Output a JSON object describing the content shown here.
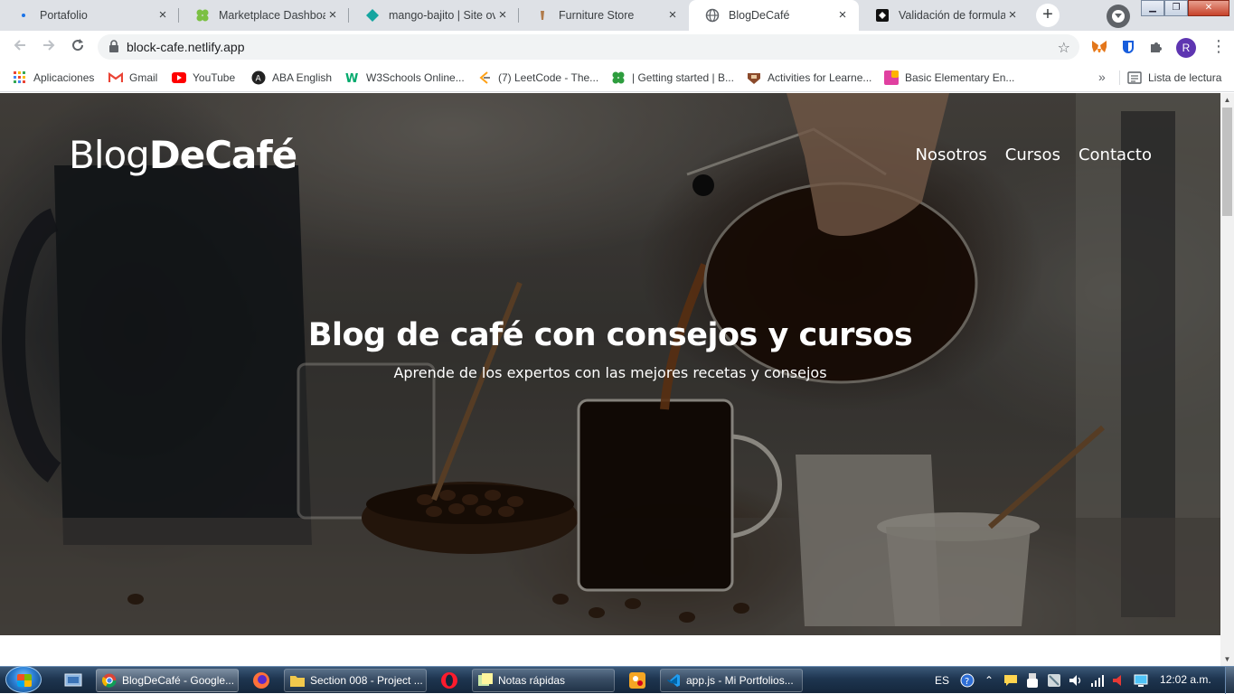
{
  "browser": {
    "tabs": [
      {
        "title": "Portafolio",
        "icon": "dot-icon",
        "active": false
      },
      {
        "title": "Marketplace Dashboard",
        "icon": "clover-icon",
        "active": false
      },
      {
        "title": "mango-bajito | Site overview",
        "icon": "netlify-icon",
        "active": false
      },
      {
        "title": "Furniture Store",
        "icon": "furniture-icon",
        "active": false
      },
      {
        "title": "BlogDeCafé",
        "icon": "globe-icon",
        "active": true
      },
      {
        "title": "Validación de formulario",
        "icon": "codepen-icon",
        "active": false
      }
    ],
    "tab_close": "×",
    "new_tab": "+",
    "url": "block-cafe.netlify.app",
    "profile_initial": "R",
    "bookmarks": [
      {
        "label": "Aplicaciones",
        "icon": "apps-grid-icon"
      },
      {
        "label": "Gmail",
        "icon": "gmail-icon"
      },
      {
        "label": "YouTube",
        "icon": "youtube-icon"
      },
      {
        "label": "ABA English",
        "icon": "aba-english-icon"
      },
      {
        "label": "W3Schools Online...",
        "icon": "w3schools-icon"
      },
      {
        "label": "(7) LeetCode - The...",
        "icon": "leetcode-icon"
      },
      {
        "label": "| Getting started | B...",
        "icon": "clover-icon"
      },
      {
        "label": "Activities for Learne...",
        "icon": "activities-icon"
      },
      {
        "label": "Basic Elementary En...",
        "icon": "elementary-icon"
      }
    ],
    "bookmarks_more": "»",
    "reading_list": "Lista de lectura"
  },
  "site": {
    "logo_light": "Blog",
    "logo_bold": "DeCafé",
    "nav": [
      "Nosotros",
      "Cursos",
      "Contacto"
    ],
    "hero_title": "Blog de café con consejos y cursos",
    "hero_subtitle": "Aprende de los expertos con las mejores recetas y consejos"
  },
  "taskbar": {
    "tasks": [
      {
        "label": "BlogDeCafé - Google...",
        "icon": "chrome-icon",
        "active": true
      },
      {
        "label": "Section 008 - Project ...",
        "icon": "folder-icon",
        "active": false
      },
      {
        "label": "Notas rápidas",
        "icon": "sticky-notes-icon",
        "active": false
      },
      {
        "label": "app.js - Mi Portfolios...",
        "icon": "vscode-icon",
        "active": false
      }
    ],
    "language": "ES",
    "clock": "12:02 a.m."
  },
  "colors": {
    "tab_strip": "#dee1e6",
    "profile_avatar": "#5e35b1",
    "hero_text": "#ffffff"
  }
}
